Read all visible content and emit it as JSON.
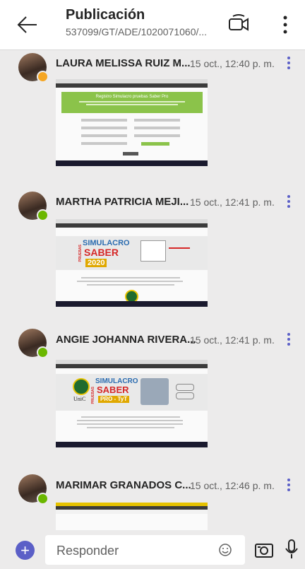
{
  "header": {
    "title": "Publicación",
    "subtitle": "537099/GT/ADE/1020071060/...",
    "back_icon": "arrow-left-icon",
    "video_icon": "video-call-icon",
    "more_icon": "more-vertical-icon"
  },
  "posts": [
    {
      "name": "LAURA MELISSA RUIZ M...",
      "time": "15 oct., 12:40 p. m.",
      "status": "away",
      "status_color": "#f5a623",
      "shot": {
        "banner": "Registro Simulacro pruebas Saber Pro"
      }
    },
    {
      "name": "MARTHA PATRICIA MEJI...",
      "time": "15 oct., 12:41 p. m.",
      "status": "available",
      "status_color": "#6bb700",
      "shot": {
        "line1": "SIMULACRO",
        "line2": "SABER",
        "line3": "2020",
        "side": "PRUEBAS"
      }
    },
    {
      "name": "ANGIE JOHANNA RIVERA...",
      "time": "15 oct., 12:41 p. m.",
      "status": "available",
      "status_color": "#6bb700",
      "shot": {
        "line1": "SIMULACRO",
        "line2": "SABER",
        "line3": "PRO - TyT",
        "side": "PRUEBAS",
        "logo": "UniC"
      }
    },
    {
      "name": "MARIMAR GRANADOS C...",
      "time": "15 oct., 12:46 p. m.",
      "status": "available",
      "status_color": "#6bb700",
      "shot": {}
    }
  ],
  "composer": {
    "placeholder": "Responder",
    "add_icon": "plus-icon",
    "emoji_icon": "emoji-icon",
    "camera_icon": "camera-icon",
    "mic_icon": "microphone-icon"
  },
  "colors": {
    "accent": "#5b5fc7",
    "green": "#6bb700",
    "away": "#f5a623",
    "banner_green": "#8bc34a"
  }
}
